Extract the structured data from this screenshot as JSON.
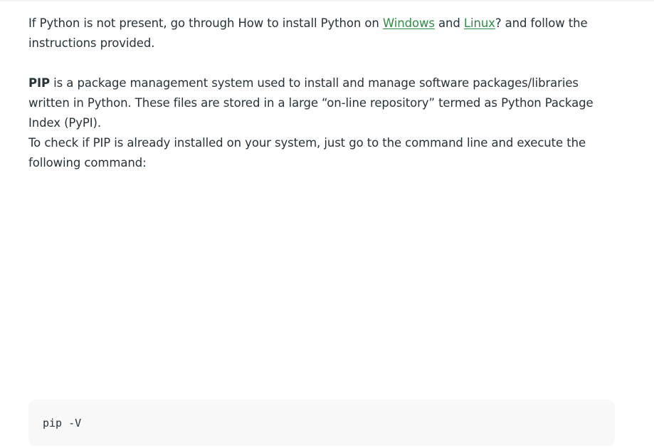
{
  "article": {
    "para1": {
      "before": "If Python is not present, go through How to install Python on ",
      "link_windows": "Windows",
      "middle": " and ",
      "link_linux": "Linux",
      "after": "? and follow the instructions provided."
    },
    "para2": {
      "term": "PIP",
      "text": " is a package management system used to install and manage software packages/libraries written in Python. These files are stored in a large “on-line repository” termed as Python Package Index (PyPI)."
    },
    "para3": {
      "text": "To check if PIP is already installed on your system, just go to the command line and execute the following command:"
    }
  },
  "code_block": {
    "command": "pip -V"
  },
  "colors": {
    "link": "#2f8d46",
    "text": "#273239",
    "code_background": "#f8f8f8"
  }
}
